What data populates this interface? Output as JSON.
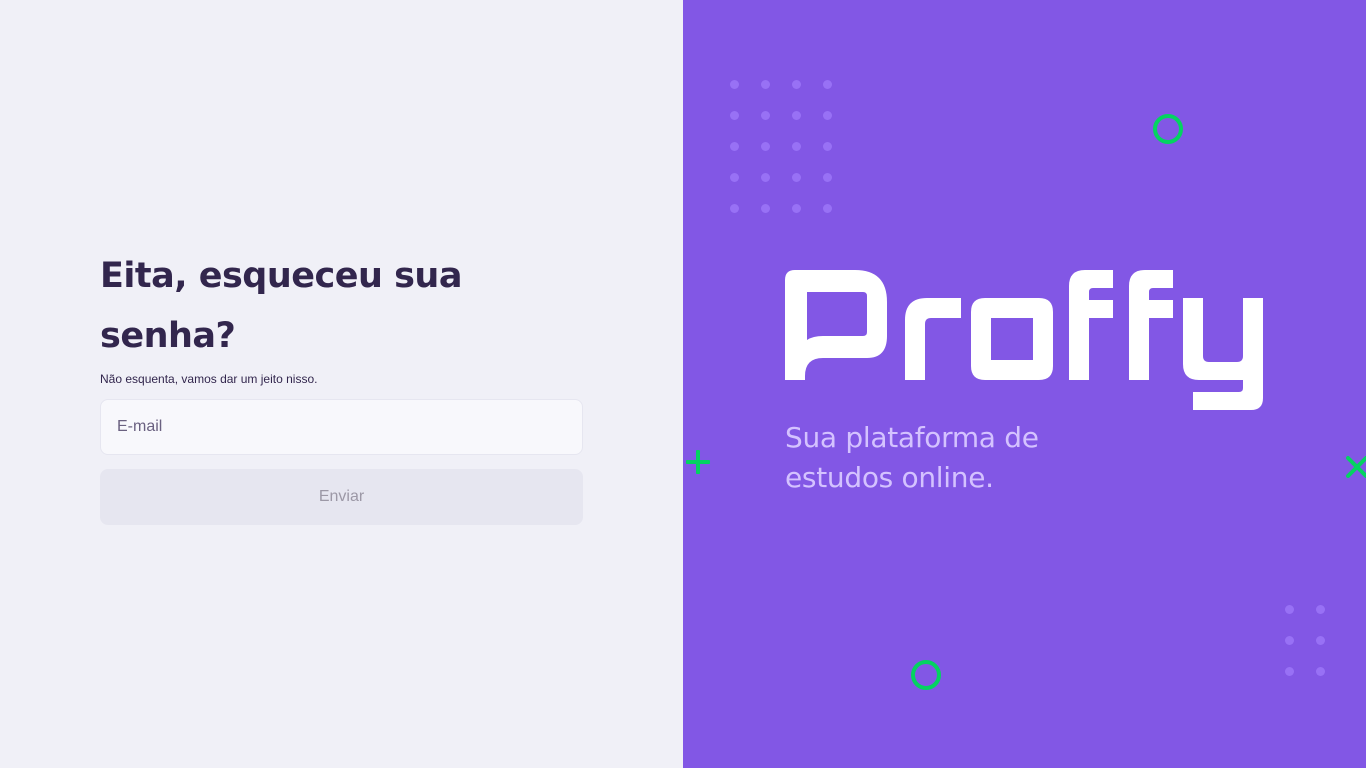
{
  "left": {
    "title": "Eita, esqueceu sua senha?",
    "subtitle": "Não esquenta, vamos dar um jeito nisso.",
    "email_placeholder": "E-mail",
    "submit_label": "Enviar"
  },
  "right": {
    "logo_text": "Proffy",
    "tagline": "Sua plataforma de estudos online."
  },
  "colors": {
    "left_background": "#F0F0F7",
    "right_background": "#8257E5",
    "title_text": "#32264D",
    "tagline_text": "#D4C2FF",
    "accent_green": "#04D361",
    "dots": "#9871F5",
    "button_disabled_bg": "#E6E6F0",
    "button_disabled_text": "#9C98A6"
  },
  "icons": [
    "plus-icon",
    "x-icon",
    "ring-icon",
    "dot-grid"
  ]
}
